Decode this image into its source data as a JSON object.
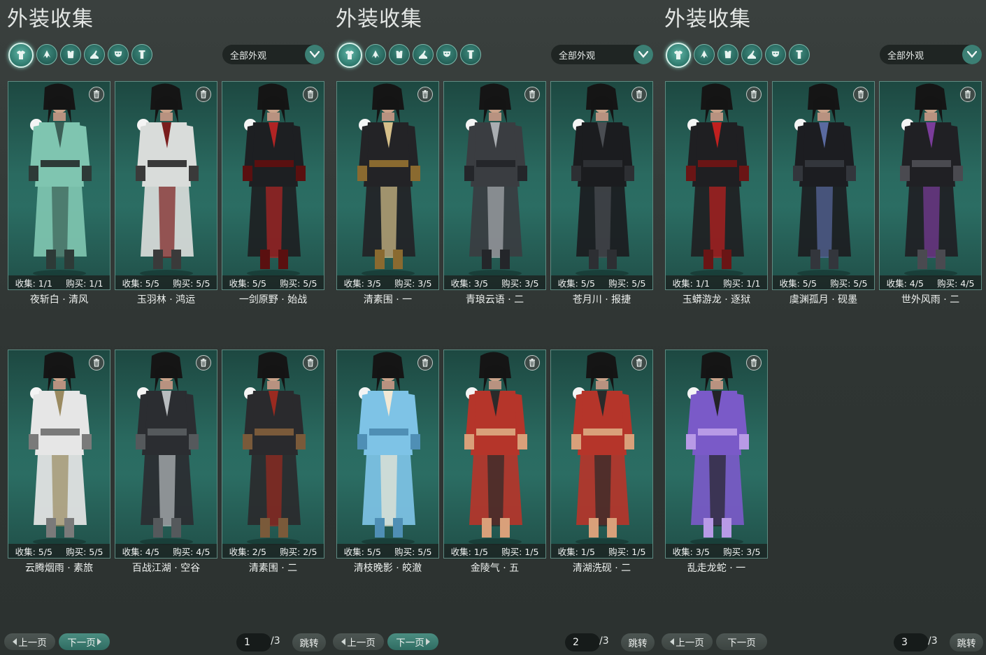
{
  "panels": [
    {
      "title": "外装收集",
      "filter_icons": [
        "all-outfits-icon",
        "hair-icon",
        "top-icon",
        "shoes-icon",
        "mask-icon",
        "accessory-icon"
      ],
      "dropdown": "全部外观",
      "pager": {
        "prev": "上一页",
        "next": "下一页",
        "page": "1",
        "total": "/3",
        "jump": "跳转"
      },
      "cards": [
        {
          "collect": "收集: 1/1",
          "buy": "购买: 1/1",
          "name": "夜斩白 · 清风",
          "colors": {
            "main": "#7fc5b0",
            "trim": "#3b5f56",
            "accent": "#2d3a37"
          }
        },
        {
          "collect": "收集: 5/5",
          "buy": "购买: 5/5",
          "name": "玉羽林 · 鸿运",
          "colors": {
            "main": "#d9dcda",
            "trim": "#7a1d1d",
            "accent": "#3a3a3a"
          }
        },
        {
          "collect": "收集: 5/5",
          "buy": "购买: 5/5",
          "name": "一剑原野 · 始战",
          "colors": {
            "main": "#1d1f22",
            "trim": "#b02424",
            "accent": "#5a1010"
          }
        },
        {
          "collect": "收集: 5/5",
          "buy": "购买: 5/5",
          "name": "云腾烟雨 · 素旅",
          "colors": {
            "main": "#e6e6e6",
            "trim": "#9a8a60",
            "accent": "#7a7a7a"
          }
        },
        {
          "collect": "收集: 4/5",
          "buy": "购买: 4/5",
          "name": "百战江湖 · 空谷",
          "colors": {
            "main": "#2b2d31",
            "trim": "#b8bcbf",
            "accent": "#55595c"
          }
        },
        {
          "collect": "收集: 2/5",
          "buy": "购买: 2/5",
          "name": "清素围 · 二",
          "colors": {
            "main": "#2a2a2d",
            "trim": "#9a2a20",
            "accent": "#7a5a3a"
          }
        }
      ]
    },
    {
      "title": "外装收集",
      "filter_icons": [
        "all-outfits-icon",
        "hair-icon",
        "top-icon",
        "shoes-icon",
        "mask-icon",
        "accessory-icon"
      ],
      "dropdown": "全部外观",
      "pager": {
        "prev": "上一页",
        "next": "下一页",
        "page": "2",
        "total": "/3",
        "jump": "跳转"
      },
      "cards": [
        {
          "collect": "收集: 3/5",
          "buy": "购买: 3/5",
          "name": "清素围 · 一",
          "colors": {
            "main": "#232326",
            "trim": "#d6c08a",
            "accent": "#8a6a30"
          }
        },
        {
          "collect": "收集: 3/5",
          "buy": "购买: 3/5",
          "name": "青琅云语 · 二",
          "colors": {
            "main": "#3a3d41",
            "trim": "#a9adb1",
            "accent": "#24262a"
          }
        },
        {
          "collect": "收集: 5/5",
          "buy": "购买: 5/5",
          "name": "苍月川 · 报捷",
          "colors": {
            "main": "#1b1c1f",
            "trim": "#4a4d52",
            "accent": "#2d2f33"
          }
        },
        {
          "collect": "收集: 5/5",
          "buy": "购买: 5/5",
          "name": "清枝晚影 · 皎澈",
          "colors": {
            "main": "#7ec3e6",
            "trim": "#f1e8d4",
            "accent": "#4f8fb5"
          }
        },
        {
          "collect": "收集: 1/5",
          "buy": "购买: 1/5",
          "name": "金陵气 · 五",
          "colors": {
            "main": "#b5352a",
            "trim": "#2a2a2a",
            "accent": "#d9a07a"
          }
        },
        {
          "collect": "收集: 1/5",
          "buy": "购买: 1/5",
          "name": "清湖洗砚 · 二",
          "colors": {
            "main": "#b5352a",
            "trim": "#2a2a2a",
            "accent": "#d9a07a"
          }
        }
      ]
    },
    {
      "title": "外装收集",
      "filter_icons": [
        "all-outfits-icon",
        "hair-icon",
        "top-icon",
        "shoes-icon",
        "mask-icon",
        "accessory-icon"
      ],
      "dropdown": "全部外观",
      "pager": {
        "prev": "上一页",
        "next": "下一页",
        "page": "3",
        "total": "/3",
        "jump": "跳转"
      },
      "cards": [
        {
          "collect": "收集: 1/1",
          "buy": "购买: 1/1",
          "name": "玉蟒游龙 · 逐狱",
          "colors": {
            "main": "#1f1f22",
            "trim": "#c0201f",
            "accent": "#6a1515"
          }
        },
        {
          "collect": "收集: 5/5",
          "buy": "购买: 5/5",
          "name": "虞渊孤月 · 砚墨",
          "colors": {
            "main": "#1c1d21",
            "trim": "#5a6aa0",
            "accent": "#33363c"
          }
        },
        {
          "collect": "收集: 4/5",
          "buy": "购买: 4/5",
          "name": "世外风雨 · 二",
          "colors": {
            "main": "#202024",
            "trim": "#7a3c9a",
            "accent": "#4a4a50"
          }
        },
        {
          "collect": "收集: 3/5",
          "buy": "购买: 3/5",
          "name": "乱走龙蛇 · 一",
          "colors": {
            "main": "#7a5ac8",
            "trim": "#232327",
            "accent": "#b89ae6"
          }
        }
      ]
    }
  ]
}
